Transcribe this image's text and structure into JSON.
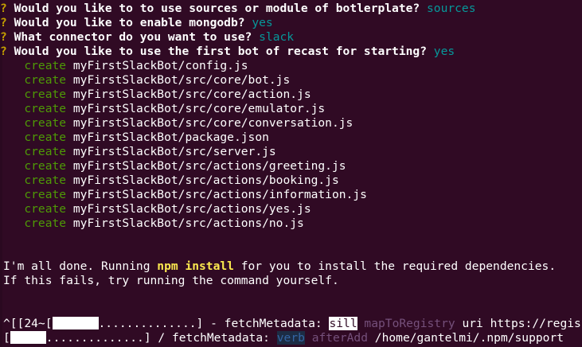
{
  "questions": [
    {
      "prefix": "?",
      "text": "Would you like to to use sources or module of botlerplate?",
      "answer": "sources"
    },
    {
      "prefix": "?",
      "text": "Would you like to enable mongodb?",
      "answer": "yes"
    },
    {
      "prefix": "?",
      "text": "What connector do you want to use?",
      "answer": "slack"
    },
    {
      "prefix": "?",
      "text": "Would you like to use the first bot of recast for starting?",
      "answer": "yes"
    }
  ],
  "create_label": "create",
  "created_files": [
    "myFirstSlackBot/config.js",
    "myFirstSlackBot/src/core/bot.js",
    "myFirstSlackBot/src/core/action.js",
    "myFirstSlackBot/src/core/emulator.js",
    "myFirstSlackBot/src/core/conversation.js",
    "myFirstSlackBot/package.json",
    "myFirstSlackBot/src/server.js",
    "myFirstSlackBot/src/actions/greeting.js",
    "myFirstSlackBot/src/actions/booking.js",
    "myFirstSlackBot/src/actions/information.js",
    "myFirstSlackBot/src/actions/yes.js",
    "myFirstSlackBot/src/actions/no.js"
  ],
  "done_message": {
    "part1": "I'm all done. Running ",
    "command": "npm install",
    "part2": " for you to install the required dependencies.",
    "line2": "If this fails, try running the command yourself."
  },
  "progress_line1": {
    "prefix": "^[[24~[",
    "dots": "..............",
    "suffix": "] - fetchMetadata: ",
    "level": "sill",
    "action": "mapToRegistry",
    "rest": "uri https://regis"
  },
  "progress_line2": {
    "prefix": "[",
    "dots": "..............",
    "suffix": "] / fetchMetadata: ",
    "level": "verb",
    "action": "afterAdd",
    "rest": "/home/gantelmi/.npm/support"
  }
}
